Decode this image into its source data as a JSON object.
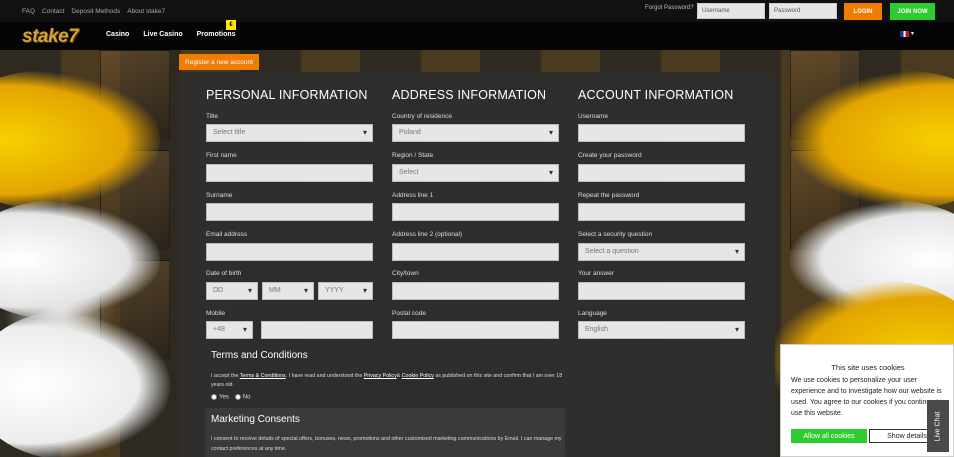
{
  "topbar": {
    "links": [
      "FAQ",
      "Contact",
      "Deposit Methods",
      "About stake7"
    ],
    "forgot_password": "Forgot Password?",
    "username_placeholder": "Username",
    "password_placeholder": "Password",
    "login_label": "LOGIN",
    "join_label": "JOIN NOW"
  },
  "navbar": {
    "logo": "stake7",
    "items": [
      "Casino",
      "Live Casino",
      "Promotions"
    ],
    "promo_badge": "€"
  },
  "register_tab": "Register a new account",
  "personal": {
    "heading": "PERSONAL INFORMATION",
    "title_label": "Title",
    "title_value": "Select title",
    "first_name_label": "First name",
    "surname_label": "Surname",
    "email_label": "Email address",
    "dob_label": "Date of birth",
    "dob_day": "DD",
    "dob_month": "MM",
    "dob_year": "YYYY",
    "mobile_label": "Mobile",
    "mobile_prefix": "+48"
  },
  "address": {
    "heading": "ADDRESS INFORMATION",
    "country_label": "Country of residence",
    "country_value": "Poland",
    "region_label": "Region / State",
    "region_value": "Select",
    "line1_label": "Address line 1",
    "line2_label": "Address line 2 (optional)",
    "city_label": "City/town",
    "postal_label": "Postal code"
  },
  "account": {
    "heading": "ACCOUNT INFORMATION",
    "username_label": "Username",
    "create_password_label": "Create your password",
    "repeat_password_label": "Repeat the password",
    "security_question_label": "Select a security question",
    "security_question_value": "Select a question",
    "answer_label": "Your answer",
    "language_label": "Language",
    "language_value": "English"
  },
  "terms": {
    "title": "Terms and Conditions",
    "text_before": "I accept the ",
    "terms_link": "Terms & Conditions",
    "text_mid": ". I have read and understood the ",
    "privacy_link": "Privacy Policy",
    "amp": "& ",
    "cookie_link": "Cookie Policy",
    "text_after": " as published on this site and confirm that I am over 18 years old.",
    "yes": "Yes",
    "no": "No"
  },
  "marketing": {
    "title": "Marketing Consents",
    "text": "I consent to receive details of special offers, bonuses, news, promotions and other customised marketing communications by Email. I can manage my contact preferences at any time."
  },
  "cookie": {
    "title": "This site uses cookies",
    "text": "We use cookies to personalize your user experience and to investigate how our website is used. You agree to our cookies if you continue to use this website.",
    "allow_label": "Allow all cookies",
    "details_label": "Show details"
  },
  "livechat_label": "Live Chat",
  "colors": {
    "orange": "#f07c00",
    "green": "#2ecc2e",
    "yellow": "#ffe600"
  }
}
